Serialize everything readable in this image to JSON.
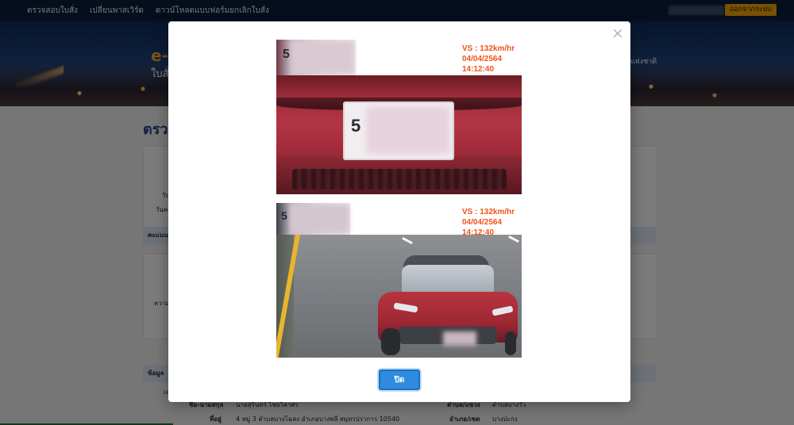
{
  "nav": {
    "links": [
      "ตรวจสอบใบสั่ง",
      "เปลี่ยนพาสเวิร์ด",
      "ดาวน์โหลดแบบฟอร์มยกเลิกใบสั่ง"
    ],
    "logout_label": "ออกจากระบบ"
  },
  "hero": {
    "brand": "e-",
    "subtitle": "ใบสั่",
    "right_text": "แห่งชาติ"
  },
  "page": {
    "title": "ตรวจ",
    "labels_left": [
      "วัน",
      "วันค",
      "คะแนน",
      "ความ",
      "ข้อมูล",
      "เล"
    ],
    "owner": {
      "name_label": "ชื่อ-นามสกุล",
      "name_value": "นายสุรินทร์ ไชยวิลาศร",
      "address_label": "ที่อยู่",
      "address_value": "4 หมู่ 3 ตำบลบางโฉลง อำเภอบางพลี สมุทรปราการ 10540",
      "subdistrict_label": "ตำบล/แขวง",
      "subdistrict_value": "ตำบลบางวัว",
      "district_label": "อำเภอ/เขต",
      "district_value": "บางปะกง"
    }
  },
  "modal": {
    "photos": [
      {
        "plate_digit": "5",
        "stamp": [
          "VS : 132km/hr",
          "04/04/2564",
          "14:12:40"
        ]
      },
      {
        "plate_digit": "5",
        "stamp": [
          "VS : 132km/hr",
          "04/04/2564",
          "14:12:40"
        ]
      }
    ],
    "close_button": "ปิด",
    "close_icon": "×"
  },
  "colors": {
    "nav_bg": "#0a1d3a",
    "logout_bg": "#f0a500",
    "stamp_text": "#f0531c",
    "close_button_bg": "#2e8be0",
    "title_text": "#1f3f8a"
  }
}
